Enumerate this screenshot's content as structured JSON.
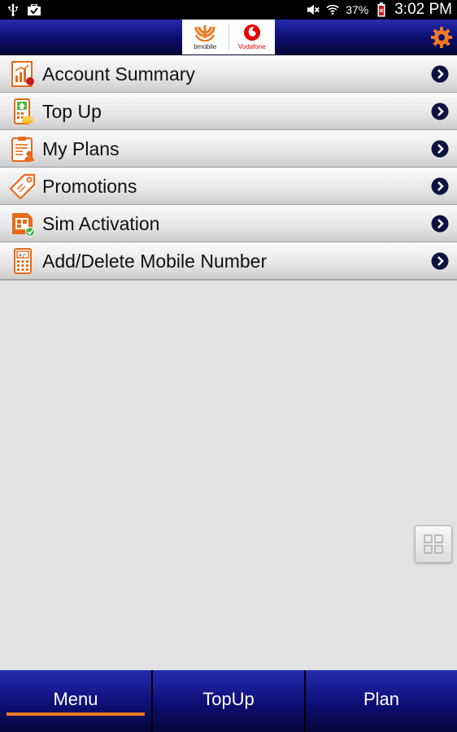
{
  "status_bar": {
    "battery": "37%",
    "time": "3:02 PM",
    "icons": [
      "usb-icon",
      "briefcase-check-icon",
      "mute-icon",
      "wifi-icon",
      "battery-icon"
    ]
  },
  "header": {
    "logos": [
      {
        "name": "bmobile",
        "label": "bmobile"
      },
      {
        "name": "vodafone",
        "label": "Vodafone"
      }
    ],
    "settings_icon": "gear-icon",
    "colors": {
      "header_bg": "#0b0d6e",
      "accent": "#f07820",
      "vodafone_red": "#e60000"
    }
  },
  "menu": {
    "items": [
      {
        "label": "Account Summary",
        "icon": "account-summary-icon"
      },
      {
        "label": "Top Up",
        "icon": "top-up-icon"
      },
      {
        "label": "My Plans",
        "icon": "my-plans-icon"
      },
      {
        "label": "Promotions",
        "icon": "promotions-tag-icon"
      },
      {
        "label": "Sim Activation",
        "icon": "sim-activation-icon"
      },
      {
        "label": "Add/Delete Mobile Number",
        "icon": "calculator-icon"
      }
    ],
    "arrow_icon": "chevron-right-circle-icon"
  },
  "floating_button": {
    "icon": "grid-icon"
  },
  "tabs": {
    "items": [
      {
        "label": "Menu",
        "active": true
      },
      {
        "label": "TopUp",
        "active": false
      },
      {
        "label": "Plan",
        "active": false
      }
    ]
  }
}
